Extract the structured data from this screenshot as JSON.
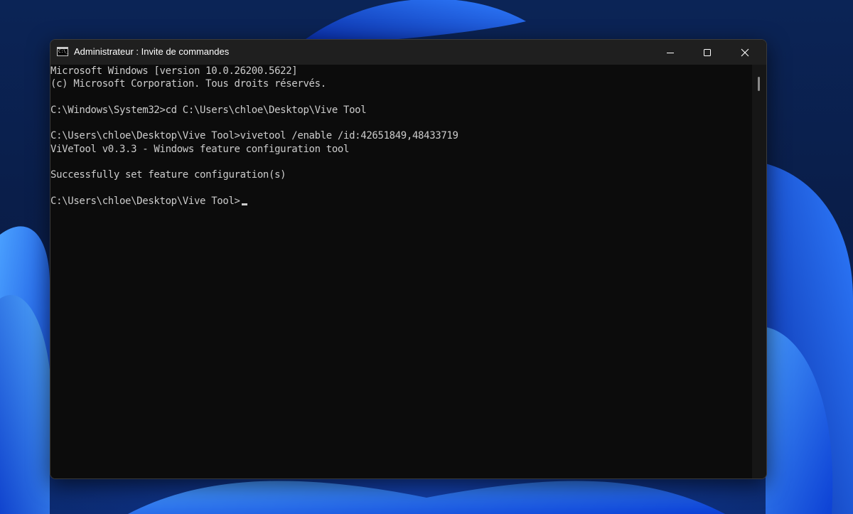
{
  "window": {
    "title": "Administrateur : Invite de commandes",
    "icon": "command-prompt-icon",
    "controls": {
      "minimize": "minimize-icon",
      "maximize": "maximize-icon",
      "close": "close-icon"
    }
  },
  "terminal": {
    "lines": [
      "Microsoft Windows [version 10.0.26200.5622]",
      "(c) Microsoft Corporation. Tous droits réservés.",
      "",
      "C:\\Windows\\System32>cd C:\\Users\\chloe\\Desktop\\Vive Tool",
      "",
      "C:\\Users\\chloe\\Desktop\\Vive Tool>vivetool /enable /id:42651849,48433719",
      "ViVeTool v0.3.3 - Windows feature configuration tool",
      "",
      "Successfully set feature configuration(s)",
      "",
      "C:\\Users\\chloe\\Desktop\\Vive Tool>"
    ]
  },
  "colors": {
    "terminal_background": "#0c0c0c",
    "terminal_text": "#cccccc",
    "title_bar": "#1f1f1f",
    "wallpaper_accent": "#1e63ff"
  }
}
